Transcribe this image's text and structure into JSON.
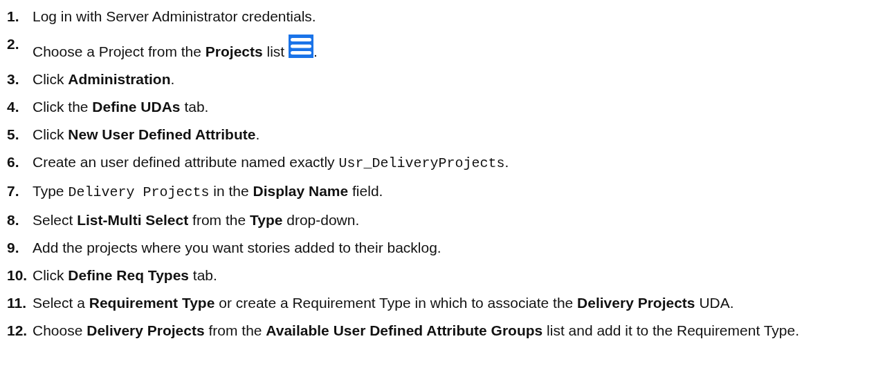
{
  "steps": [
    {
      "number": "1.",
      "parts": [
        {
          "kind": "text",
          "text": "Log in with Server Administrator credentials."
        }
      ]
    },
    {
      "number": "2.",
      "parts": [
        {
          "kind": "text",
          "text": "Choose a Project from the **Projects** list "
        },
        {
          "kind": "icon"
        },
        {
          "kind": "text",
          "text": "."
        }
      ]
    },
    {
      "number": "3.",
      "parts": [
        {
          "kind": "text",
          "text": "Click **Administration**."
        }
      ]
    },
    {
      "number": "4.",
      "parts": [
        {
          "kind": "text",
          "text": "Click the **Define UDAs** tab."
        }
      ]
    },
    {
      "number": "5.",
      "parts": [
        {
          "kind": "text",
          "text": "Click **New User Defined Attribute**."
        }
      ]
    },
    {
      "number": "6.",
      "parts": [
        {
          "kind": "text",
          "text": "Create an user defined attribute named exactly "
        },
        {
          "kind": "code",
          "text": "Usr_DeliveryProjects"
        },
        {
          "kind": "text",
          "text": "."
        }
      ]
    },
    {
      "number": "7.",
      "parts": [
        {
          "kind": "text",
          "text": "Type "
        },
        {
          "kind": "code",
          "text": "Delivery Projects"
        },
        {
          "kind": "text",
          "text": " in the **Display Name** field."
        }
      ]
    },
    {
      "number": "8.",
      "parts": [
        {
          "kind": "text",
          "text": "Select **List-Multi Select** from the **Type** drop-down."
        }
      ]
    },
    {
      "number": "9.",
      "parts": [
        {
          "kind": "text",
          "text": "Add the projects where you want stories added to their backlog."
        }
      ]
    },
    {
      "number": "10.",
      "parts": [
        {
          "kind": "text",
          "text": "Click **Define Req Types** tab."
        }
      ]
    },
    {
      "number": "11.",
      "parts": [
        {
          "kind": "text",
          "text": "Select a **Requirement Type** or create a Requirement Type in which to associate the **Delivery Projects** UDA."
        }
      ]
    },
    {
      "number": "12.",
      "parts": [
        {
          "kind": "text",
          "text": "Choose **Delivery Projects** from the **Available User Defined Attribute Groups** list and add it to the Requirement Type."
        }
      ]
    }
  ]
}
